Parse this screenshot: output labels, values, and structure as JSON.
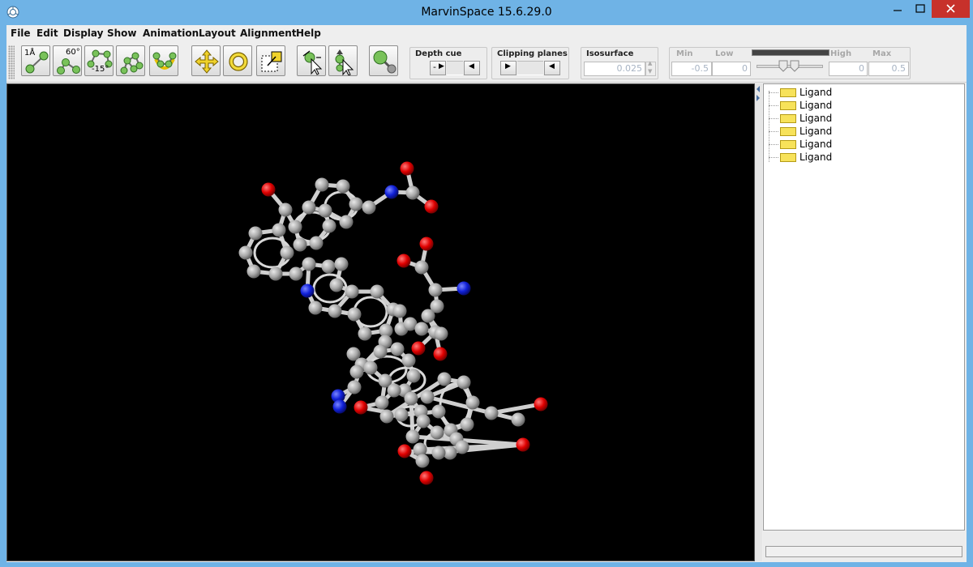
{
  "window": {
    "title": "MarvinSpace 15.6.29.0"
  },
  "menu": {
    "items": [
      "File",
      "Edit",
      "Display",
      "Show",
      "Animation",
      "Layout",
      "Alignment",
      "Help"
    ]
  },
  "toolbar": {
    "measure_distance_label": "1Å",
    "measure_angle_label": "60°",
    "measure_dihedral_label": "-15°",
    "depth_cue": {
      "title": "Depth cue",
      "button_label": "-"
    },
    "clipping_planes": {
      "title": "Clipping planes"
    },
    "isosurface": {
      "title": "Isosurface",
      "value": "0.025"
    },
    "range": {
      "min_label": "Min",
      "low_label": "Low",
      "high_label": "High",
      "max_label": "Max",
      "min_value": "-0.5",
      "low_value": "0",
      "high_value": "0",
      "max_value": "0.5"
    }
  },
  "tree": {
    "items": [
      "Ligand",
      "Ligand",
      "Ligand",
      "Ligand",
      "Ligand",
      "Ligand"
    ]
  },
  "colors": {
    "carbon": "#a9a9a9",
    "oxygen": "#e00000",
    "nitrogen": "#1020d8",
    "titlebar": "#6fb3e6",
    "close_button": "#c7312b",
    "folder": "#f7e25a"
  }
}
